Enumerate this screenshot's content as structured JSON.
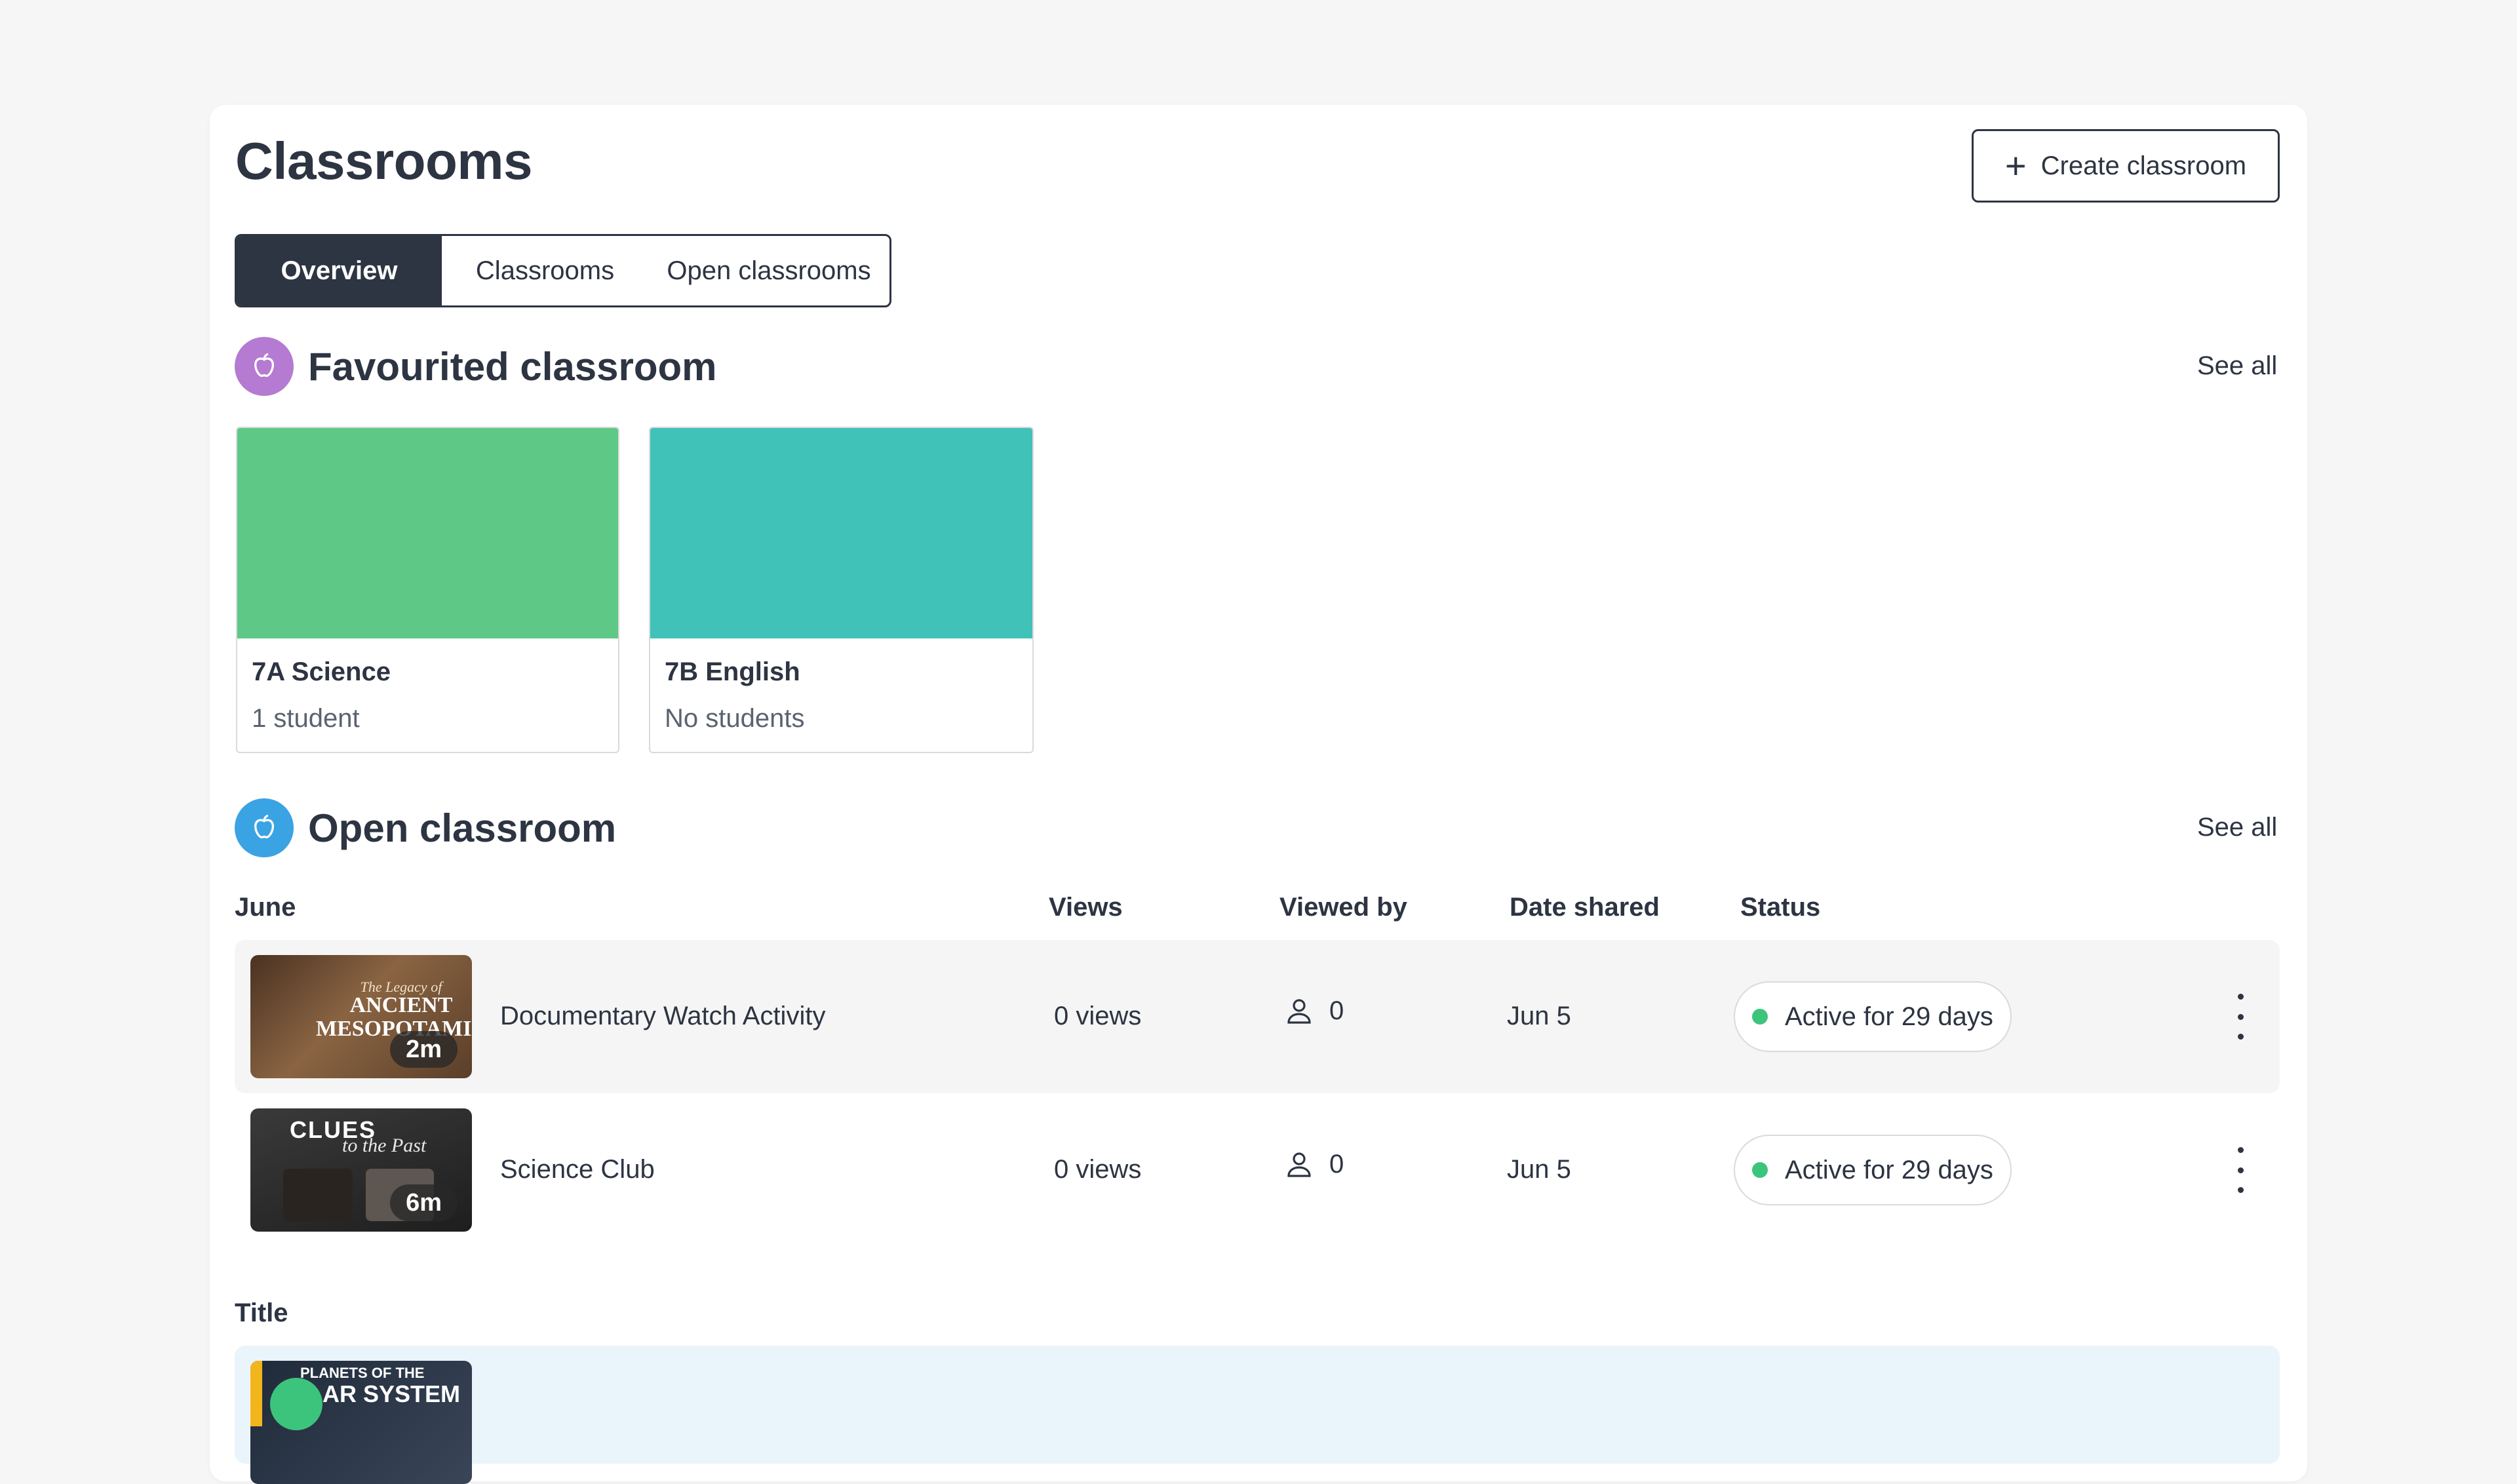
{
  "header": {
    "title": "Classrooms",
    "create_label": "Create classroom"
  },
  "tabs": [
    {
      "label": "Overview",
      "active": true
    },
    {
      "label": "Classrooms",
      "active": false
    },
    {
      "label": "Open classrooms",
      "active": false
    }
  ],
  "favourited": {
    "title": "Favourited classroom",
    "see_all": "See all",
    "icon": "apple-icon",
    "icon_color": "#b57ad1",
    "cards": [
      {
        "name": "7A Science",
        "sub": "1 student",
        "color": "#5ec887"
      },
      {
        "name": "7B English",
        "sub": "No students",
        "color": "#40c2b9"
      }
    ]
  },
  "open": {
    "title": "Open classroom",
    "see_all": "See all",
    "icon": "apple-icon",
    "icon_color": "#3aa3e3",
    "columns": {
      "group": "June",
      "views": "Views",
      "viewed_by": "Viewed by",
      "date_shared": "Date shared",
      "status": "Status"
    },
    "rows": [
      {
        "title": "Documentary Watch Activity",
        "views": "0 views",
        "viewed_by": "0",
        "date": "Jun 5",
        "status": "Active for 29 days",
        "duration": "2m",
        "thumb_text_1": "The Legacy of",
        "thumb_text_2": "ANCIENT",
        "thumb_text_3": "MESOPOTAMIA"
      },
      {
        "title": "Science Club",
        "views": "0 views",
        "viewed_by": "0",
        "date": "Jun 5",
        "status": "Active for 29 days",
        "duration": "6m",
        "thumb_text_1": "CLUES",
        "thumb_text_2": "to the Past"
      }
    ],
    "second_group": "Title",
    "third_thumb_text_1": "PLANETS OF THE",
    "third_thumb_text_2": "AR SYSTEM"
  },
  "colors": {
    "dark": "#2d3442",
    "status_green": "#3cc47c",
    "row_grey": "#f5f5f5",
    "row_blue": "#eaf4fb"
  }
}
